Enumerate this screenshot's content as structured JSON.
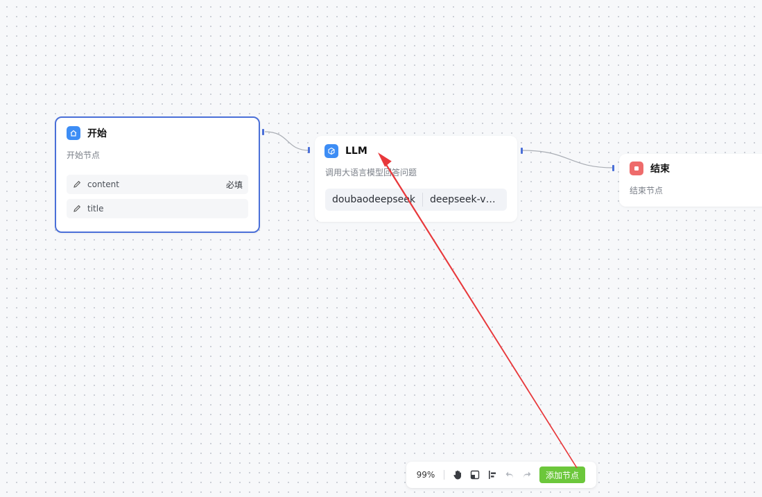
{
  "nodes": {
    "start": {
      "title": "开始",
      "desc": "开始节点",
      "fields": [
        {
          "name": "content",
          "required": "必填"
        },
        {
          "name": "title",
          "required": ""
        }
      ],
      "icon": "home-icon",
      "icon_color": "#3d8df5"
    },
    "llm": {
      "title": "LLM",
      "desc": "调用大语言模型回答问题",
      "provider": "doubaodeepseek",
      "model": "deepseek-v3-1-…",
      "icon": "cube-icon",
      "icon_color": "#3d8df5"
    },
    "end": {
      "title": "结束",
      "desc": "结束节点",
      "icon": "stop-icon",
      "icon_color": "#ee6b6b"
    }
  },
  "toolbar": {
    "zoom": "99%",
    "add_node_label": "添加节点",
    "tools": [
      "hand-icon",
      "minimap-icon",
      "align-icon",
      "undo-icon",
      "redo-icon"
    ]
  },
  "colors": {
    "accent": "#4a6fd8",
    "add_button": "#6cc73b",
    "annotation_arrow": "#e8383b"
  }
}
